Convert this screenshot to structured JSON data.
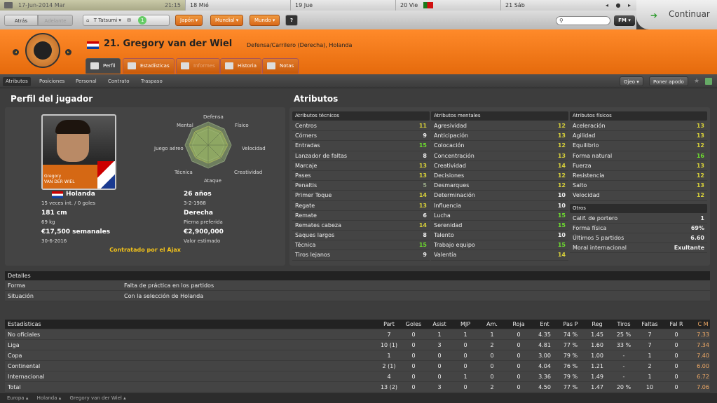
{
  "calendar": {
    "today": "17-Jun-2014 Mar",
    "time": "21:15",
    "days": [
      "18 Mié",
      "19 Jue",
      "20 Vie",
      "21 Sáb"
    ],
    "nav": "◂ ● ▸"
  },
  "continue_label": "Continuar",
  "toolbar": {
    "back": "Atrás",
    "forward": "Adelante",
    "manager": "T Tatsumi",
    "badge": "1",
    "menus": [
      "Japón",
      "Mundial",
      "Mundo"
    ],
    "help": "?",
    "fm": "FM"
  },
  "player": {
    "title": "21. Gregory van der Wiel",
    "position": "Defensa/Carrilero (Derecha), Holanda"
  },
  "tabs": [
    "Perfil",
    "Estadísticas",
    "Informes",
    "Historia",
    "Notas"
  ],
  "subnav": [
    "Atributos",
    "Posiciones",
    "Personal",
    "Contrato",
    "Traspaso"
  ],
  "right_buttons": {
    "scout": "Ojeo",
    "nickname": "Poner apodo"
  },
  "profile": {
    "heading": "Perfil del jugador",
    "photo_caption_1": "Gregory",
    "photo_caption_2": "VAN DER WIEL",
    "radar": [
      "Defensa",
      "Físico",
      "Velocidad",
      "Creatividad",
      "Ataque",
      "Técnica",
      "Juego aéreo",
      "Mental"
    ],
    "nation": "Holanda",
    "caps": "15 veces int. / 0 goles",
    "age": "26 años",
    "dob": "3-2-1988",
    "height": "181 cm",
    "weight": "69 kg",
    "foot": "Derecha",
    "foot_label": "Pierna preferida",
    "wage": "€17,500 semanales",
    "contract_end": "30-6-2016",
    "value": "€2,900,000",
    "value_label": "Valor estimado",
    "contracted": "Contratado por el Ajax"
  },
  "attributes": {
    "heading": "Atributos",
    "technical": {
      "title": "Atributos técnicos",
      "rows": [
        {
          "n": "Centros",
          "v": "11",
          "c": "y"
        },
        {
          "n": "Córners",
          "v": "9",
          "c": "w"
        },
        {
          "n": "Entradas",
          "v": "15",
          "c": "g"
        },
        {
          "n": "Lanzador de faltas",
          "v": "8",
          "c": "w"
        },
        {
          "n": "Marcaje",
          "v": "13",
          "c": "y"
        },
        {
          "n": "Pases",
          "v": "13",
          "c": "y"
        },
        {
          "n": "Penaltis",
          "v": "5",
          "c": "lg"
        },
        {
          "n": "Primer Toque",
          "v": "14",
          "c": "y"
        },
        {
          "n": "Regate",
          "v": "13",
          "c": "y"
        },
        {
          "n": "Remate",
          "v": "6",
          "c": "w"
        },
        {
          "n": "Remates cabeza",
          "v": "14",
          "c": "y"
        },
        {
          "n": "Saques largos",
          "v": "8",
          "c": "w"
        },
        {
          "n": "Técnica",
          "v": "15",
          "c": "g"
        },
        {
          "n": "Tiros lejanos",
          "v": "9",
          "c": "w"
        }
      ]
    },
    "mental": {
      "title": "Atributos mentales",
      "rows": [
        {
          "n": "Agresividad",
          "v": "12",
          "c": "y"
        },
        {
          "n": "Anticipación",
          "v": "13",
          "c": "y"
        },
        {
          "n": "Colocación",
          "v": "12",
          "c": "y"
        },
        {
          "n": "Concentración",
          "v": "13",
          "c": "y"
        },
        {
          "n": "Creatividad",
          "v": "14",
          "c": "y"
        },
        {
          "n": "Decisiones",
          "v": "12",
          "c": "y"
        },
        {
          "n": "Desmarques",
          "v": "12",
          "c": "y"
        },
        {
          "n": "Determinación",
          "v": "10",
          "c": "w"
        },
        {
          "n": "Influencia",
          "v": "10",
          "c": "w"
        },
        {
          "n": "Lucha",
          "v": "15",
          "c": "g"
        },
        {
          "n": "Serenidad",
          "v": "15",
          "c": "g"
        },
        {
          "n": "Talento",
          "v": "10",
          "c": "w"
        },
        {
          "n": "Trabajo equipo",
          "v": "15",
          "c": "g"
        },
        {
          "n": "Valentía",
          "v": "14",
          "c": "y"
        }
      ]
    },
    "physical": {
      "title": "Atributos físicos",
      "rows": [
        {
          "n": "Aceleración",
          "v": "13",
          "c": "y"
        },
        {
          "n": "Agilidad",
          "v": "13",
          "c": "y"
        },
        {
          "n": "Equilibrio",
          "v": "12",
          "c": "y"
        },
        {
          "n": "Forma natural",
          "v": "16",
          "c": "g"
        },
        {
          "n": "Fuerza",
          "v": "13",
          "c": "y"
        },
        {
          "n": "Resistencia",
          "v": "12",
          "c": "y"
        },
        {
          "n": "Salto",
          "v": "13",
          "c": "y"
        },
        {
          "n": "Velocidad",
          "v": "12",
          "c": "y"
        }
      ]
    },
    "other": {
      "title": "Otros",
      "rows": [
        {
          "n": "Calif. de portero",
          "v": "1",
          "c": "w"
        },
        {
          "n": "Forma física",
          "v": "69%",
          "c": "w"
        },
        {
          "n": "Últimos 5 partidos",
          "v": "6.60",
          "c": "w"
        },
        {
          "n": "Moral internacional",
          "v": "Exultante",
          "c": "w"
        }
      ]
    }
  },
  "details": {
    "title": "Detalles",
    "rows": [
      {
        "label": "Forma",
        "value": "Falta de práctica en los partidos"
      },
      {
        "label": "Situación",
        "value": "Con la selección de Holanda"
      }
    ]
  },
  "stats": {
    "title": "Estadísticas",
    "columns": [
      "Part",
      "Goles",
      "Asist",
      "MJP",
      "Am.",
      "Roja",
      "Ent",
      "Pas P",
      "Reg",
      "Tiros",
      "Faltas",
      "Fal R",
      "C M"
    ],
    "rows": [
      {
        "label": "No oficiales",
        "vals": [
          "7",
          "0",
          "1",
          "1",
          "1",
          "0",
          "4.35",
          "74 %",
          "1.45",
          "25 %",
          "7",
          "0",
          "7.33"
        ]
      },
      {
        "label": "Liga",
        "vals": [
          "10 (1)",
          "0",
          "3",
          "0",
          "2",
          "0",
          "4.81",
          "77 %",
          "1.60",
          "33 %",
          "7",
          "0",
          "7.34"
        ]
      },
      {
        "label": "Copa",
        "vals": [
          "1",
          "0",
          "0",
          "0",
          "0",
          "0",
          "3.00",
          "79 %",
          "1.00",
          "-",
          "1",
          "0",
          "7.40"
        ]
      },
      {
        "label": "Continental",
        "vals": [
          "2 (1)",
          "0",
          "0",
          "0",
          "0",
          "0",
          "4.04",
          "76 %",
          "1.21",
          "-",
          "2",
          "0",
          "6.00"
        ]
      },
      {
        "label": "Internacional",
        "vals": [
          "4",
          "0",
          "0",
          "1",
          "0",
          "0",
          "3.36",
          "79 %",
          "1.49",
          "-",
          "1",
          "0",
          "6.72"
        ]
      },
      {
        "label": "Total",
        "vals": [
          "13 (2)",
          "0",
          "3",
          "0",
          "2",
          "0",
          "4.50",
          "77 %",
          "1.47",
          "20 %",
          "10",
          "0",
          "7.06"
        ]
      }
    ]
  },
  "breadcrumb": [
    "Europa ▴",
    "Holanda ▴",
    "Gregory van der Wiel ▴"
  ],
  "colors": {
    "accent": "#e56a0c",
    "good": "#6ede2e",
    "mid": "#d9d23a",
    "cm": "#f0aa66"
  }
}
